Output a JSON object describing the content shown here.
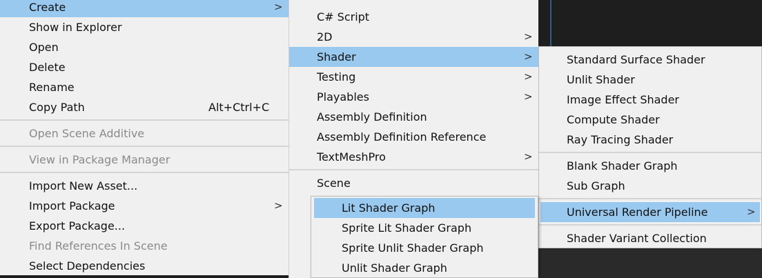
{
  "menu_main": {
    "create": "Create",
    "show_in_explorer": "Show in Explorer",
    "open": "Open",
    "delete": "Delete",
    "rename": "Rename",
    "copy_path": "Copy Path",
    "copy_path_shortcut": "Alt+Ctrl+C",
    "open_scene_additive": "Open Scene Additive",
    "view_in_package_manager": "View in Package Manager",
    "import_new_asset": "Import New Asset...",
    "import_package": "Import Package",
    "export_package": "Export Package...",
    "find_references_in_scene": "Find References In Scene",
    "select_dependencies": "Select Dependencies"
  },
  "menu_create": {
    "csharp_script": "C# Script",
    "two_d": "2D",
    "shader": "Shader",
    "testing": "Testing",
    "playables": "Playables",
    "assembly_definition": "Assembly Definition",
    "assembly_definition_reference": "Assembly Definition Reference",
    "textmeshpro": "TextMeshPro",
    "scene": "Scene"
  },
  "menu_shader": {
    "standard_surface_shader": "Standard Surface Shader",
    "unlit_shader": "Unlit Shader",
    "image_effect_shader": "Image Effect Shader",
    "compute_shader": "Compute Shader",
    "ray_tracing_shader": "Ray Tracing Shader",
    "blank_shader_graph": "Blank Shader Graph",
    "sub_graph": "Sub Graph",
    "universal_render_pipeline": "Universal Render Pipeline",
    "shader_variant_collection": "Shader Variant Collection"
  },
  "menu_urp": {
    "lit_shader_graph": "Lit Shader Graph",
    "sprite_lit_shader_graph": "Sprite Lit Shader Graph",
    "sprite_unlit_shader_graph": "Sprite Unlit Shader Graph",
    "unlit_shader_graph": "Unlit Shader Graph"
  },
  "arrow_glyph": ">",
  "colors": {
    "menu_bg": "#f0f0f0",
    "highlight": "#99c9ef",
    "disabled_text": "#8a8a8a",
    "backdrop": "#1e1e1e"
  }
}
